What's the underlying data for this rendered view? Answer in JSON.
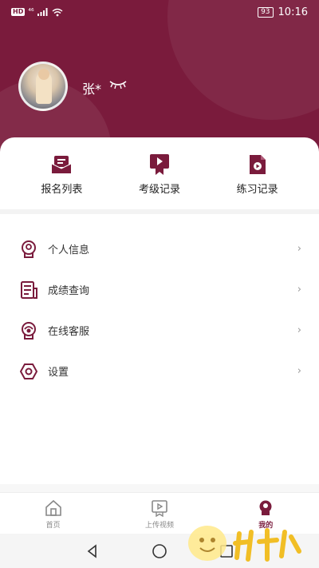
{
  "status_bar": {
    "hd_badge": "HD",
    "signal": "⁴⁶",
    "battery": "93",
    "time": "10:16"
  },
  "profile": {
    "username": "张*",
    "avatar_icon": "avatar-photo",
    "eye_icon": "closed-eye-icon"
  },
  "quick_actions": [
    {
      "label": "报名列表",
      "icon": "registration-list-icon"
    },
    {
      "label": "考级记录",
      "icon": "exam-record-icon"
    },
    {
      "label": "练习记录",
      "icon": "practice-record-icon"
    }
  ],
  "menu": [
    {
      "label": "个人信息",
      "icon": "personal-info-icon"
    },
    {
      "label": "成绩查询",
      "icon": "score-query-icon"
    },
    {
      "label": "在线客服",
      "icon": "customer-service-icon"
    },
    {
      "label": "设置",
      "icon": "settings-icon"
    }
  ],
  "bottom_nav": [
    {
      "label": "首页",
      "icon": "home-icon"
    },
    {
      "label": "上传视频",
      "icon": "upload-video-icon"
    },
    {
      "label": "我的",
      "icon": "profile-icon",
      "active": true
    }
  ],
  "colors": {
    "brand": "#7a1b3c",
    "header_bg": "#7a1b3c",
    "inactive": "#888888"
  }
}
